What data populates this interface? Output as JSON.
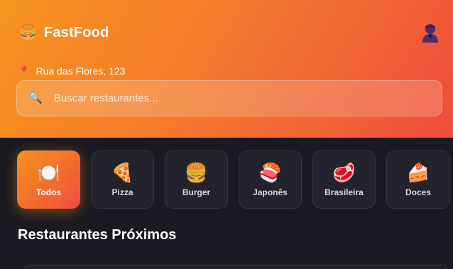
{
  "header": {
    "logo_icon": "🍔",
    "app_name": "FastFood",
    "location_icon": "📍",
    "location": "Rua das Flores, 123",
    "search": {
      "icon": "🔍",
      "placeholder": "Buscar restaurantes..."
    }
  },
  "categories": [
    {
      "icon": "🍽️",
      "label": "Todos",
      "active": true
    },
    {
      "icon": "🍕",
      "label": "Pizza",
      "active": false
    },
    {
      "icon": "🍔",
      "label": "Burger",
      "active": false
    },
    {
      "icon": "🍣",
      "label": "Japonês",
      "active": false
    },
    {
      "icon": "🥩",
      "label": "Brasileira",
      "active": false
    },
    {
      "icon": "🍰",
      "label": "Doces",
      "active": false
    }
  ],
  "section_title": "Restaurantes Próximos",
  "colors": {
    "gradient_start": "#f7931e",
    "gradient_end": "#ee4d3c",
    "background": "#1a1a22",
    "card_bg": "#23232d"
  }
}
